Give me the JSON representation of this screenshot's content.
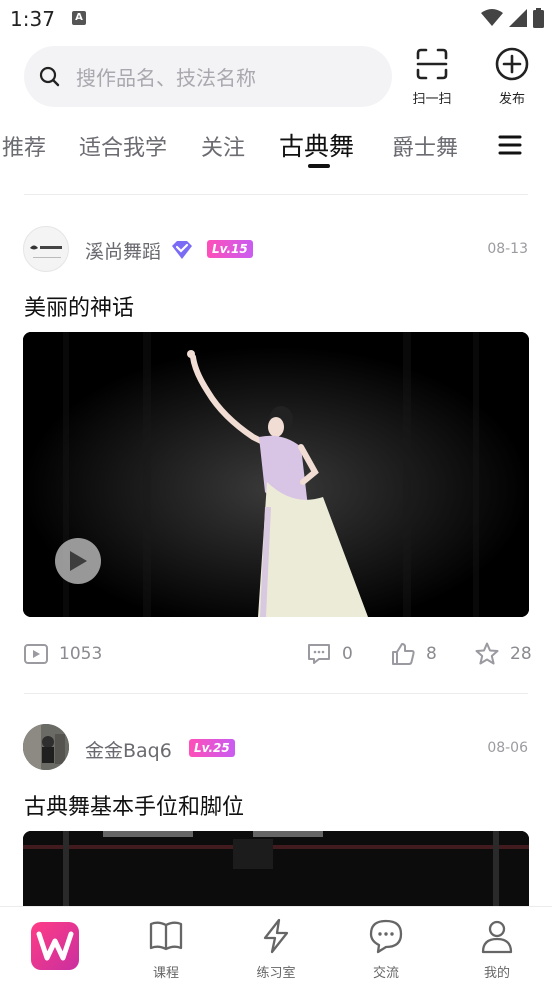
{
  "status_bar": {
    "time": "1:37",
    "notification_letter": "A"
  },
  "search": {
    "placeholder": "搜作品名、技法名称"
  },
  "header_buttons": {
    "scan_label": "扫一扫",
    "publish_label": "发布"
  },
  "tabs": [
    {
      "label": "推荐",
      "active": false
    },
    {
      "label": "适合我学",
      "active": false
    },
    {
      "label": "关注",
      "active": false
    },
    {
      "label": "古典舞",
      "active": true
    },
    {
      "label": "爵士舞",
      "active": false
    }
  ],
  "posts": [
    {
      "author": "溪尚舞蹈",
      "verified": true,
      "level": "Lv.15",
      "date": "08-13",
      "title": "美丽的神话",
      "stats": {
        "views": "1053",
        "comments": "0",
        "likes": "8",
        "favorites": "28"
      }
    },
    {
      "author": "金金Baq6",
      "verified": false,
      "level": "Lv.25",
      "date": "08-06",
      "title": "古典舞基本手位和脚位"
    }
  ],
  "bottom_nav": [
    {
      "label": "",
      "icon": "app-logo-icon"
    },
    {
      "label": "课程",
      "icon": "book-icon"
    },
    {
      "label": "练习室",
      "icon": "lightning-icon"
    },
    {
      "label": "交流",
      "icon": "chat-icon"
    },
    {
      "label": "我的",
      "icon": "person-icon"
    }
  ],
  "colors": {
    "accent": "#ff3d86",
    "level_badge": "#d64fe0",
    "verify": "#7b6cf6"
  }
}
